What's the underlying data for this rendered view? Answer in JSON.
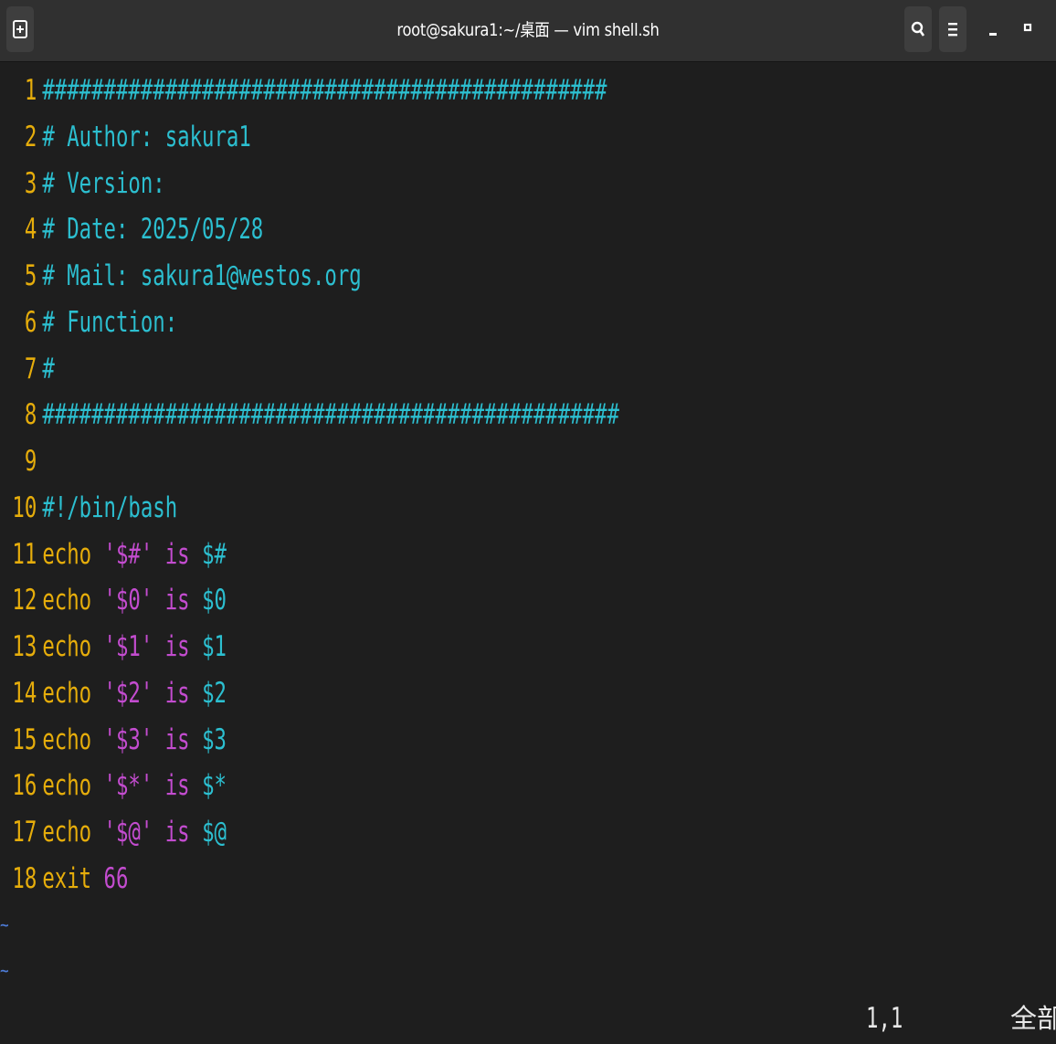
{
  "window": {
    "title": "root@sakura1:~/桌面 — vim shell.sh",
    "buttons": {
      "new_tab_icon": "new-tab-icon",
      "search_icon": "search-icon",
      "menu_icon": "hamburger-menu-icon",
      "minimize_icon": "minimize-icon",
      "maximize_icon": "maximize-icon"
    }
  },
  "editor": {
    "lines": [
      {
        "num": "1",
        "text": "##############################################"
      },
      {
        "num": "2",
        "text": "# Author: sakura1"
      },
      {
        "num": "3",
        "text": "# Version:"
      },
      {
        "num": "4",
        "text": "# Date: 2025/05/28"
      },
      {
        "num": "5",
        "text": "# Mail: sakura1@westos.org"
      },
      {
        "num": "6",
        "text": "# Function:"
      },
      {
        "num": "7",
        "text": "#"
      },
      {
        "num": "8",
        "text": "###############################################"
      },
      {
        "num": "9",
        "text": ""
      },
      {
        "num": "10",
        "text": "#!/bin/bash"
      },
      {
        "num": "11",
        "cmd": "echo",
        "q": "'$#'",
        "kw": "is",
        "var": "$#"
      },
      {
        "num": "12",
        "cmd": "echo",
        "q": "'$0'",
        "kw": "is",
        "var": "$0"
      },
      {
        "num": "13",
        "cmd": "echo",
        "q": "'$1'",
        "kw": "is",
        "var": "$1"
      },
      {
        "num": "14",
        "cmd": "echo",
        "q": "'$2'",
        "kw": "is",
        "var": "$2"
      },
      {
        "num": "15",
        "cmd": "echo",
        "q": "'$3'",
        "kw": "is",
        "var": "$3"
      },
      {
        "num": "16",
        "cmd": "echo",
        "q": "'$*'",
        "kw": "is",
        "var": "$*"
      },
      {
        "num": "17",
        "cmd": "echo",
        "q": "'$@'",
        "kw": "is",
        "var": "$@"
      },
      {
        "num": "18",
        "cmd": "exit",
        "arg": "66"
      }
    ],
    "empty_line_marker": "~"
  },
  "status": {
    "cursor_position": "1,1",
    "scroll_position": "全部"
  },
  "colors": {
    "background": "#1e1e1e",
    "comment": "#2cbfd0",
    "line_number": "#e6ad0b",
    "command": "#e6ad0b",
    "string_keyword": "#c34ccf",
    "variable": "#2cbfd0",
    "tilde": "#4d7bd6"
  }
}
